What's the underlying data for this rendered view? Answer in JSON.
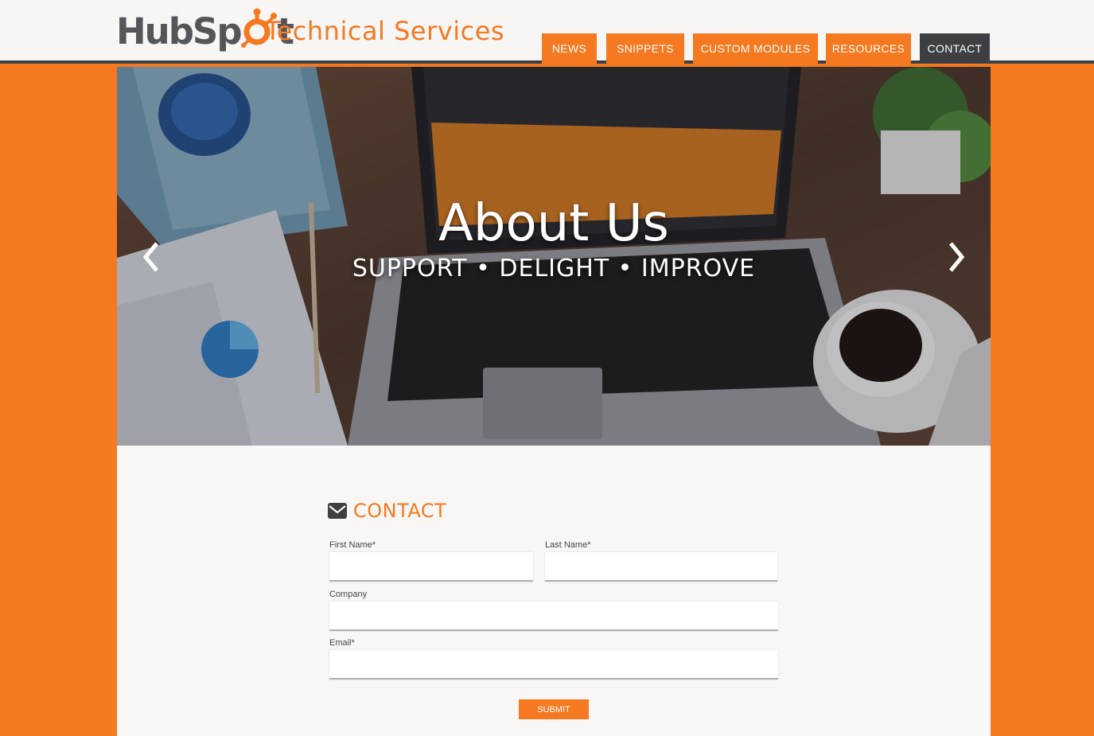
{
  "brand": {
    "logo_text_a": "HubSp",
    "logo_text_b": "t",
    "site_title": "Technical Services",
    "accent": "#f47920",
    "dark": "#3d3f43"
  },
  "nav": {
    "items": [
      {
        "label": "NEWS"
      },
      {
        "label": "SNIPPETS"
      },
      {
        "label": "CUSTOM MODULES"
      },
      {
        "label": "RESOURCES"
      },
      {
        "label": "CONTACT",
        "active": true
      }
    ]
  },
  "hero": {
    "title": "About Us",
    "subtitle": "SUPPORT  •  DELIGHT  •  IMPROVE",
    "prev_icon": "chevron-left-icon",
    "next_icon": "chevron-right-icon"
  },
  "contact": {
    "heading": "CONTACT",
    "icon": "envelope-icon",
    "first_name_label": "First Name*",
    "last_name_label": "Last Name*",
    "company_label": "Company",
    "email_label": "Email*",
    "submit_label": "SUBMIT"
  }
}
